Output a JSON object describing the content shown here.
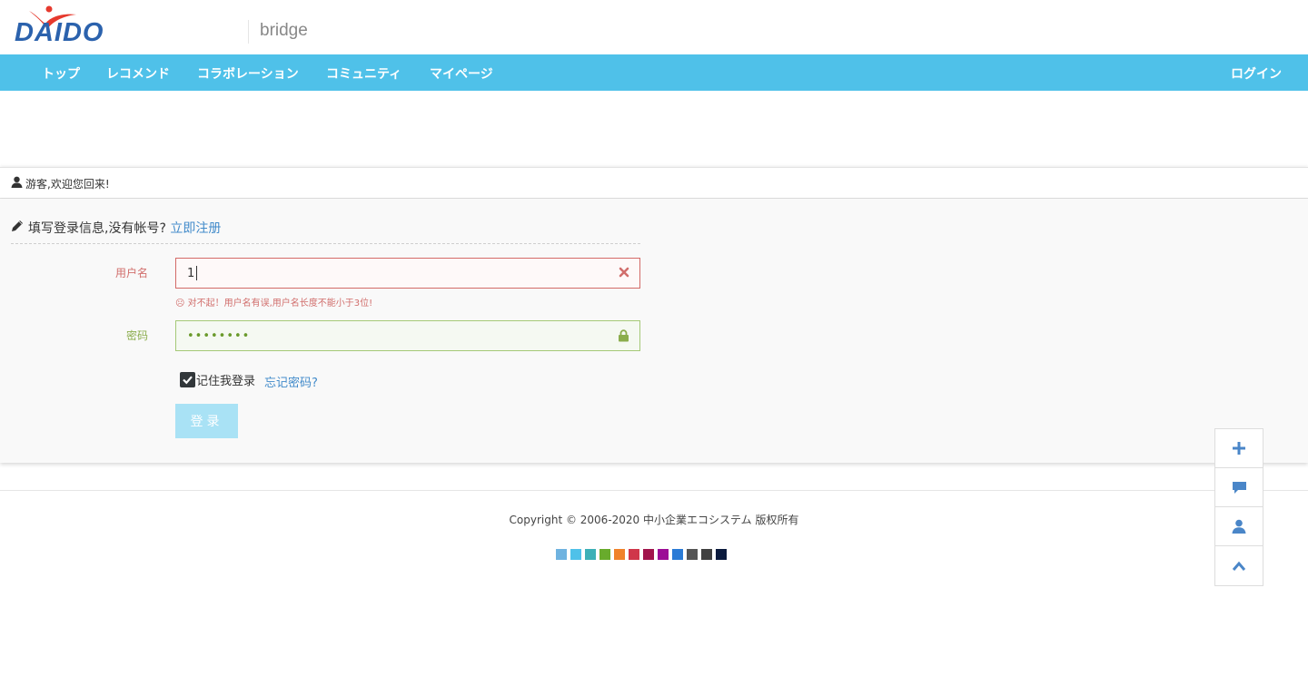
{
  "header": {
    "logo_text": "DAIDO",
    "site_name": "bridge"
  },
  "nav": {
    "items": [
      "トップ",
      "レコメンド",
      "コラボレーション",
      "コミュニティ",
      "マイページ"
    ],
    "login_label": "ログイン"
  },
  "welcome": {
    "text": "游客,欢迎您回来!"
  },
  "login_form": {
    "heading": "填写登录信息,没有帐号?",
    "register_link": "立即注册",
    "username_label": "用户名",
    "username_value": "1",
    "error_message": "☹ 对不起！用户名有误,用户名长度不能小于3位!",
    "password_label": "密码",
    "password_mask": "••••••••",
    "remember_label": "记住我登录",
    "remember_checked": true,
    "forgot_link": "忘记密码?",
    "submit_label": "登录"
  },
  "footer": {
    "copyright": "Copyright © 2006-2020 中小企業エコシステム 版权所有",
    "theme_colors": [
      "#6fb3e0",
      "#4fc1e9",
      "#3cb0b7",
      "#68ab2c",
      "#f0822a",
      "#d0364a",
      "#a1154c",
      "#9c0c96",
      "#2a7bd6",
      "#555555",
      "#404040",
      "#0b1a3d"
    ]
  },
  "float_toolbar": {
    "icons": [
      "plus-icon",
      "comment-icon",
      "user-icon",
      "chevron-up-icon"
    ]
  },
  "colors": {
    "nav_bg": "#4fc1e9",
    "brand_blue": "#2b62ad",
    "error": "#d16e6c",
    "success": "#8bad4c"
  }
}
